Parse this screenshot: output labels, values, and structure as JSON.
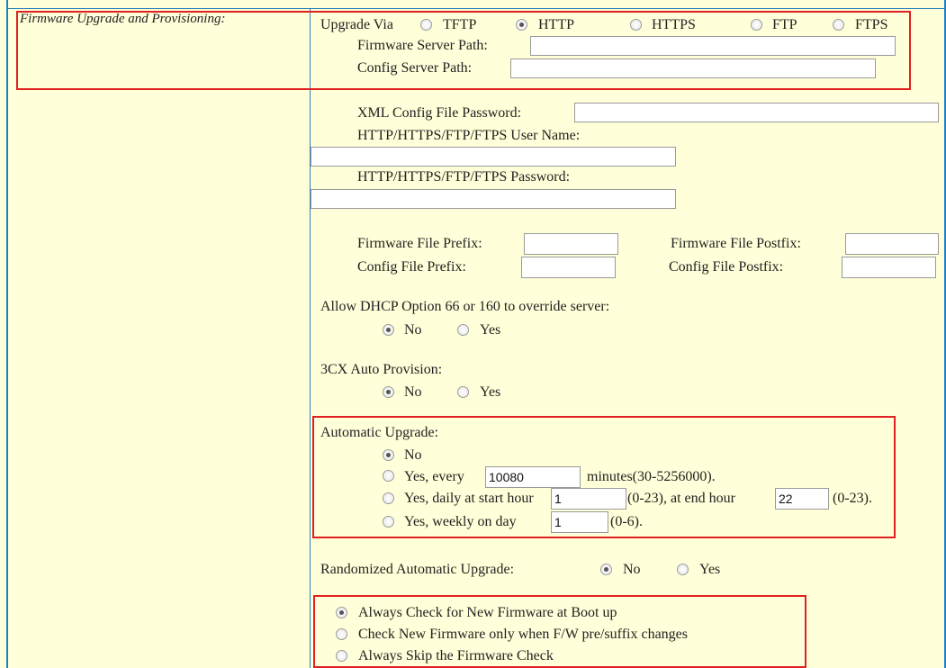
{
  "section_label": "Firmware Upgrade and Provisioning:",
  "upgrade_via": {
    "label": "Upgrade Via",
    "options": [
      "TFTP",
      "HTTP",
      "HTTPS",
      "FTP",
      "FTPS"
    ],
    "selected": "HTTP"
  },
  "firmware_server_path": {
    "label": "Firmware Server Path:",
    "value": ""
  },
  "config_server_path": {
    "label": "Config Server Path:",
    "value": ""
  },
  "xml_config_password": {
    "label": "XML Config File Password:",
    "value": ""
  },
  "user_name": {
    "label": "HTTP/HTTPS/FTP/FTPS User Name:",
    "value": ""
  },
  "password": {
    "label": "HTTP/HTTPS/FTP/FTPS Password:",
    "value": ""
  },
  "firmware_prefix": {
    "label": "Firmware File Prefix:",
    "value": ""
  },
  "firmware_postfix": {
    "label": "Firmware File Postfix:",
    "value": ""
  },
  "config_prefix": {
    "label": "Config File Prefix:",
    "value": ""
  },
  "config_postfix": {
    "label": "Config File Postfix:",
    "value": ""
  },
  "dhcp_override": {
    "label": "Allow DHCP Option 66 or 160 to override server:",
    "no": "No",
    "yes": "Yes",
    "selected": "No"
  },
  "auto_provision": {
    "label": "3CX Auto Provision:",
    "no": "No",
    "yes": "Yes",
    "selected": "No"
  },
  "automatic_upgrade": {
    "label": "Automatic Upgrade:",
    "selected": "No",
    "no": "No",
    "every_pre": "Yes, every",
    "every_value": "10080",
    "every_post": "minutes(30-5256000).",
    "daily_pre": "Yes, daily at start hour",
    "daily_start": "1",
    "daily_mid": "(0-23), at end hour",
    "daily_end": "22",
    "daily_post": "(0-23).",
    "weekly_pre": "Yes, weekly on day",
    "weekly_value": "1",
    "weekly_post": "(0-6)."
  },
  "randomized": {
    "label": "Randomized Automatic Upgrade:",
    "no": "No",
    "yes": "Yes",
    "selected": "No"
  },
  "firmware_check": {
    "selected": "always_boot",
    "always_boot": "Always Check for New Firmware at Boot up",
    "on_change": "Check New Firmware only when F/W pre/suffix changes",
    "skip": "Always Skip the Firmware Check"
  },
  "colors": {
    "background": "#ffffd9",
    "border_blue": "#1f7fc2",
    "highlight_red": "#e02020"
  }
}
